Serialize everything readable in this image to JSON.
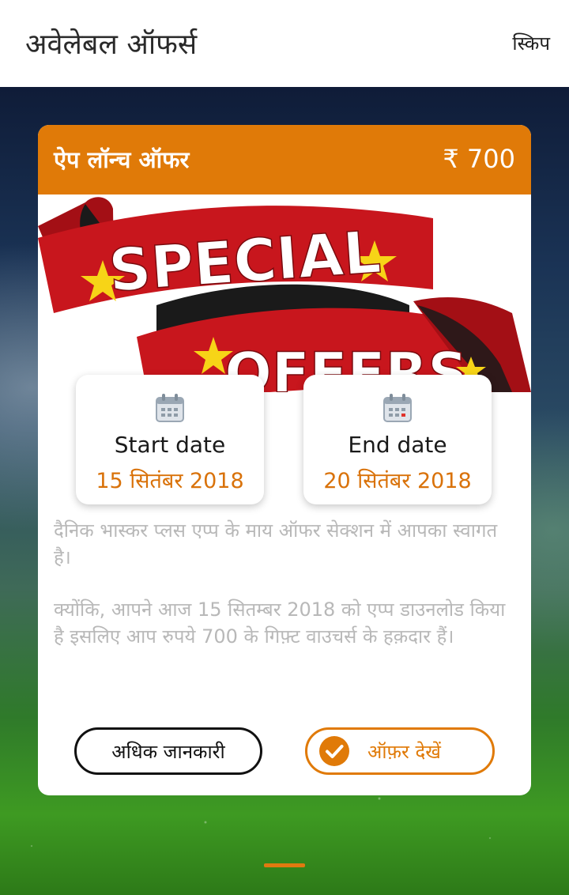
{
  "app_bar": {
    "title": "अवेलेबल ऑफर्स",
    "skip_label": "स्किप"
  },
  "offer_card": {
    "title": "ऐप लॉन्च ऑफर",
    "amount": "₹ 700",
    "banner": {
      "line1": "SPECIAL",
      "line2": "OFFERS"
    },
    "start": {
      "label": "Start date",
      "value": "15 सितंबर 2018",
      "icon": "calendar-icon"
    },
    "end": {
      "label": "End date",
      "value": "20 सितंबर 2018",
      "icon": "calendar-icon"
    },
    "description": [
      "दैनिक भास्कर प्लस एप्प के माय ऑफर सेक्शन में आपका स्वागत है।",
      "क्योंकि, आपने आज 15 सितम्बर 2018 को एप्प डाउनलोड किया है इसलिए आप रुपये 700 के गिफ़्ट वाउचर्स के हक़दार हैं।"
    ],
    "more_info_label": "अधिक जानकारी",
    "view_offer_label": "ऑफ़र देखें"
  },
  "colors": {
    "accent": "#e07a08",
    "header_text": "#ffffff",
    "ribbon_red": "#c8161d",
    "star_yellow": "#f7d417"
  }
}
